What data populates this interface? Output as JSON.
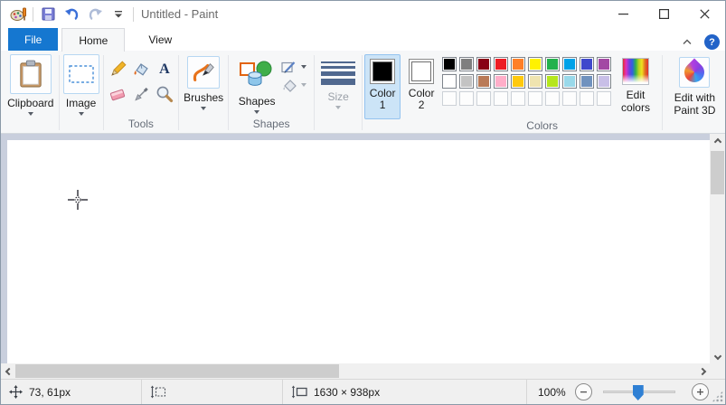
{
  "window": {
    "title": "Untitled - Paint"
  },
  "titlebar": {
    "icons": [
      "paint-logo-icon",
      "save-icon",
      "undo-icon",
      "redo-icon",
      "customize-qat-icon",
      "minimize-icon",
      "maximize-icon",
      "close-icon"
    ]
  },
  "tabs": [
    {
      "label": "File"
    },
    {
      "label": "Home",
      "active": true
    },
    {
      "label": "View"
    }
  ],
  "ribbon_right": {
    "help_glyph": "?"
  },
  "ribbon": {
    "clipboard": {
      "label": "Clipboard"
    },
    "image": {
      "label": "Image"
    },
    "tools": {
      "caption": "Tools",
      "text_glyph": "A",
      "items": [
        "pencil-tool",
        "fill-tool",
        "text-tool",
        "eraser-tool",
        "eyedropper-tool",
        "magnifier-tool"
      ]
    },
    "brushes": {
      "label": "Brushes"
    },
    "shapes": {
      "label": "Shapes",
      "caption": "Shapes",
      "options": [
        "shape-outline",
        "shape-fill"
      ]
    },
    "size": {
      "label": "Size",
      "disabled": true
    },
    "colors": {
      "color1_label": "Color 1",
      "color2_label": "Color 2",
      "caption": "Colors",
      "edit_colors_label": "Edit colors",
      "color1_value": "#000000",
      "color2_value": "#FFFFFF",
      "palette_rows": [
        [
          "#000000",
          "#7F7F7F",
          "#880015",
          "#ED1C24",
          "#FF7F27",
          "#FFF200",
          "#22B14C",
          "#00A2E8",
          "#3F48CC",
          "#A349A4"
        ],
        [
          "#FFFFFF",
          "#C3C3C3",
          "#B97A57",
          "#FFAEC9",
          "#FFC90E",
          "#EFE4B0",
          "#B5E61D",
          "#99D9EA",
          "#7092BE",
          "#C8BFE7"
        ],
        [
          null,
          null,
          null,
          null,
          null,
          null,
          null,
          null,
          null,
          null
        ]
      ]
    },
    "paint3d": {
      "label": "Edit with Paint 3D"
    }
  },
  "statusbar": {
    "cursor_position": "73, 61px",
    "selection_size": "",
    "canvas_size": "1630 × 938px",
    "zoom_level": "100%"
  },
  "colors": {
    "accent_blue": "#1577d0",
    "selection_bg": "#cce4f7",
    "selection_border": "#94c3ef",
    "workarea_bg": "#c9cfdd",
    "canvas_bg": "#ffffff"
  }
}
